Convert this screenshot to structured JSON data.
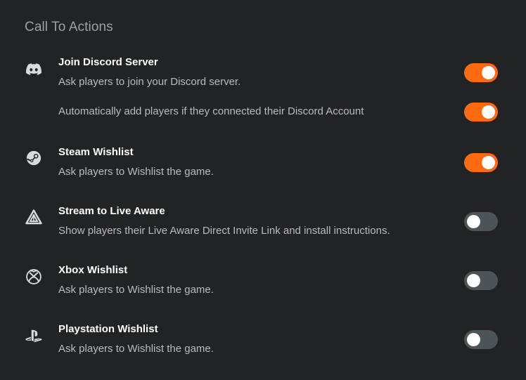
{
  "section": {
    "title": "Call To Actions"
  },
  "items": [
    {
      "icon": "discord-icon",
      "title": "Join Discord Server",
      "description": "Ask players to join your Discord server.",
      "enabled": true,
      "sub_option": {
        "description": "Automatically add players if they connected their Discord Account",
        "enabled": true
      }
    },
    {
      "icon": "steam-icon",
      "title": "Steam Wishlist",
      "description": "Ask players to Wishlist the game.",
      "enabled": true
    },
    {
      "icon": "live-aware-icon",
      "title": "Stream to Live Aware",
      "description": "Show players their Live Aware Direct Invite Link and install instructions.",
      "enabled": false
    },
    {
      "icon": "xbox-icon",
      "title": "Xbox Wishlist",
      "description": "Ask players to Wishlist the game.",
      "enabled": false
    },
    {
      "icon": "playstation-icon",
      "title": "Playstation Wishlist",
      "description": "Ask players to Wishlist the game.",
      "enabled": false
    }
  ],
  "colors": {
    "background": "#212325",
    "toggle_on": "#ff6a13",
    "toggle_off": "#4d5457",
    "section_title": "#9ba1a6",
    "description_text": "#b8bcc0"
  }
}
